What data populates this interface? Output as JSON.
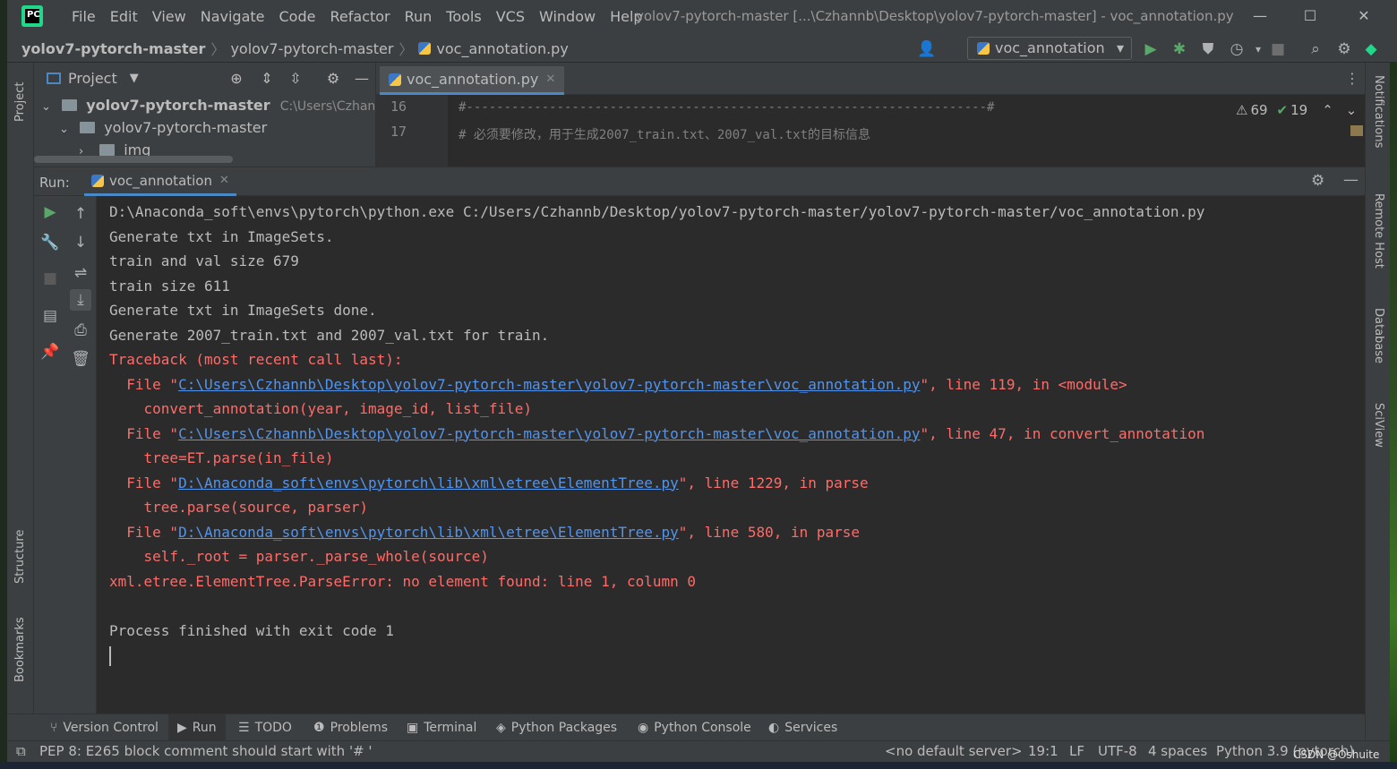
{
  "window": {
    "title": "yolov7-pytorch-master [...\\Czhannb\\Desktop\\yolov7-pytorch-master] - voc_annotation.py",
    "app_logo": "PC",
    "minimize": "—",
    "maximize": "☐",
    "close": "✕"
  },
  "menu": [
    "File",
    "Edit",
    "View",
    "Navigate",
    "Code",
    "Refactor",
    "Run",
    "Tools",
    "VCS",
    "Window",
    "Help"
  ],
  "breadcrumb": {
    "root": "yolov7-pytorch-master",
    "folder": "yolov7-pytorch-master",
    "file": "voc_annotation.py",
    "sep": "〉"
  },
  "toolbar": {
    "run_config": "voc_annotation",
    "icons": [
      "user-icon",
      "run-icon",
      "debug-icon",
      "coverage-icon",
      "profile-icon",
      "stop-icon",
      "search-icon",
      "settings-icon",
      "update-icon"
    ]
  },
  "project": {
    "title": "Project",
    "root_label": "yolov7-pytorch-master",
    "root_path": "C:\\Users\\Czhannb\\De",
    "child": "yolov7-pytorch-master",
    "grandchild": "img"
  },
  "editor": {
    "tab": "voc_annotation.py",
    "line1_num": "16",
    "line1_text": "#---------------------------------------------------------------------#",
    "line2_num": "17",
    "line2_text": "#   必须要修改，用于生成2007_train.txt、2007_val.txt的目标信息",
    "warnings": "69",
    "checks": "19"
  },
  "left_stripe": {
    "project": "Project",
    "structure": "Structure",
    "bookmarks": "Bookmarks"
  },
  "right_stripe": {
    "notifications": "Notifications",
    "remote_host": "Remote Host",
    "database": "Database",
    "sciview": "SciView"
  },
  "run": {
    "label": "Run:",
    "tab": "voc_annotation"
  },
  "console": {
    "l1": "D:\\Anaconda_soft\\envs\\pytorch\\python.exe C:/Users/Czhannb/Desktop/yolov7-pytorch-master/yolov7-pytorch-master/voc_annotation.py",
    "l2": "Generate txt in ImageSets.",
    "l3": "train and val size 679",
    "l4": "train size 611",
    "l5": "Generate txt in ImageSets done.",
    "l6": "Generate 2007_train.txt and 2007_val.txt for train.",
    "l7": "Traceback (most recent call last):",
    "f1_pre": "  File \"",
    "f1_link": "C:\\Users\\Czhannb\\Desktop\\yolov7-pytorch-master\\yolov7-pytorch-master\\voc_annotation.py",
    "f1_post": "\", line 119, in <module>",
    "f1_code": "    convert_annotation(year, image_id, list_file)",
    "f2_pre": "  File \"",
    "f2_link": "C:\\Users\\Czhannb\\Desktop\\yolov7-pytorch-master\\yolov7-pytorch-master\\voc_annotation.py",
    "f2_post": "\", line 47, in convert_annotation",
    "f2_code": "    tree=ET.parse(in_file)",
    "f3_pre": "  File \"",
    "f3_link": "D:\\Anaconda_soft\\envs\\pytorch\\lib\\xml\\etree\\ElementTree.py",
    "f3_post": "\", line 1229, in parse",
    "f3_code": "    tree.parse(source, parser)",
    "f4_pre": "  File \"",
    "f4_link": "D:\\Anaconda_soft\\envs\\pytorch\\lib\\xml\\etree\\ElementTree.py",
    "f4_post": "\", line 580, in parse",
    "f4_code": "    self._root = parser._parse_whole(source)",
    "error": "xml.etree.ElementTree.ParseError: no element found: line 1, column 0",
    "finished": "Process finished with exit code 1"
  },
  "tool_tabs": [
    "Version Control",
    "Run",
    "TODO",
    "Problems",
    "Terminal",
    "Python Packages",
    "Python Console",
    "Services"
  ],
  "status": {
    "message": "PEP 8: E265 block comment should start with '# '",
    "server": "<no default server>",
    "position": "19:1",
    "line_sep": "LF",
    "encoding": "UTF-8",
    "indent": "4 spaces",
    "interpreter": "Python 3.9 (pytorch)"
  },
  "watermark": "CSDN @Oshuite",
  "colors": {
    "accent": "#4a88c7",
    "error": "#ff6b68",
    "link": "#5394ec",
    "run_green": "#59a869"
  }
}
